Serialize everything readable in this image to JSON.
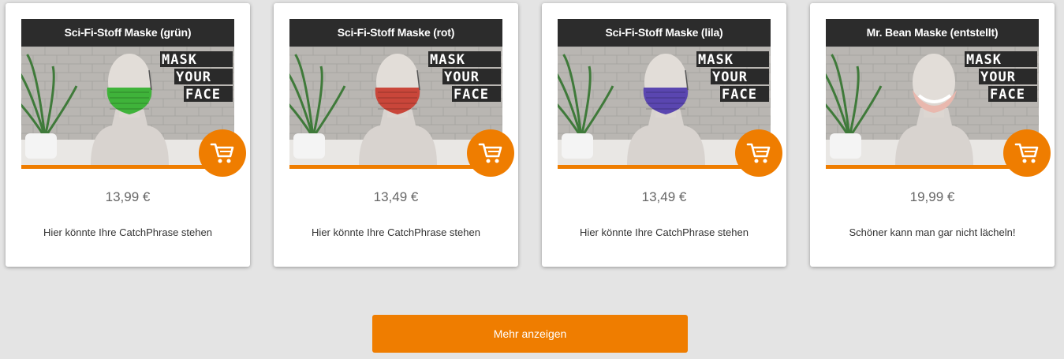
{
  "products": [
    {
      "title": "Sci-Fi-Stoff Maske (grün)",
      "price": "13,99 €",
      "catchphrase": "Hier könnte Ihre CatchPhrase stehen",
      "mask_color": "#3fb33a",
      "mask_style": "fabric"
    },
    {
      "title": "Sci-Fi-Stoff Maske (rot)",
      "price": "13,49 €",
      "catchphrase": "Hier könnte Ihre CatchPhrase stehen",
      "mask_color": "#c9463a",
      "mask_style": "fabric"
    },
    {
      "title": "Sci-Fi-Stoff Maske (lila)",
      "price": "13,49 €",
      "catchphrase": "Hier könnte Ihre CatchPhrase stehen",
      "mask_color": "#5a46b0",
      "mask_style": "fabric"
    },
    {
      "title": "Mr. Bean Maske (entstellt)",
      "price": "19,99 €",
      "catchphrase": "Schöner kann man gar nicht lächeln!",
      "mask_color": "#e9b8ae",
      "mask_style": "smile"
    }
  ],
  "photo_text": [
    "MASK",
    "YOUR",
    "FACE"
  ],
  "cart_icon": "shopping-cart-icon",
  "load_more": {
    "label": "Mehr anzeigen"
  },
  "colors": {
    "accent": "#ef7d00",
    "title_bar": "#2c2c2c",
    "background": "#e4e4e4"
  }
}
